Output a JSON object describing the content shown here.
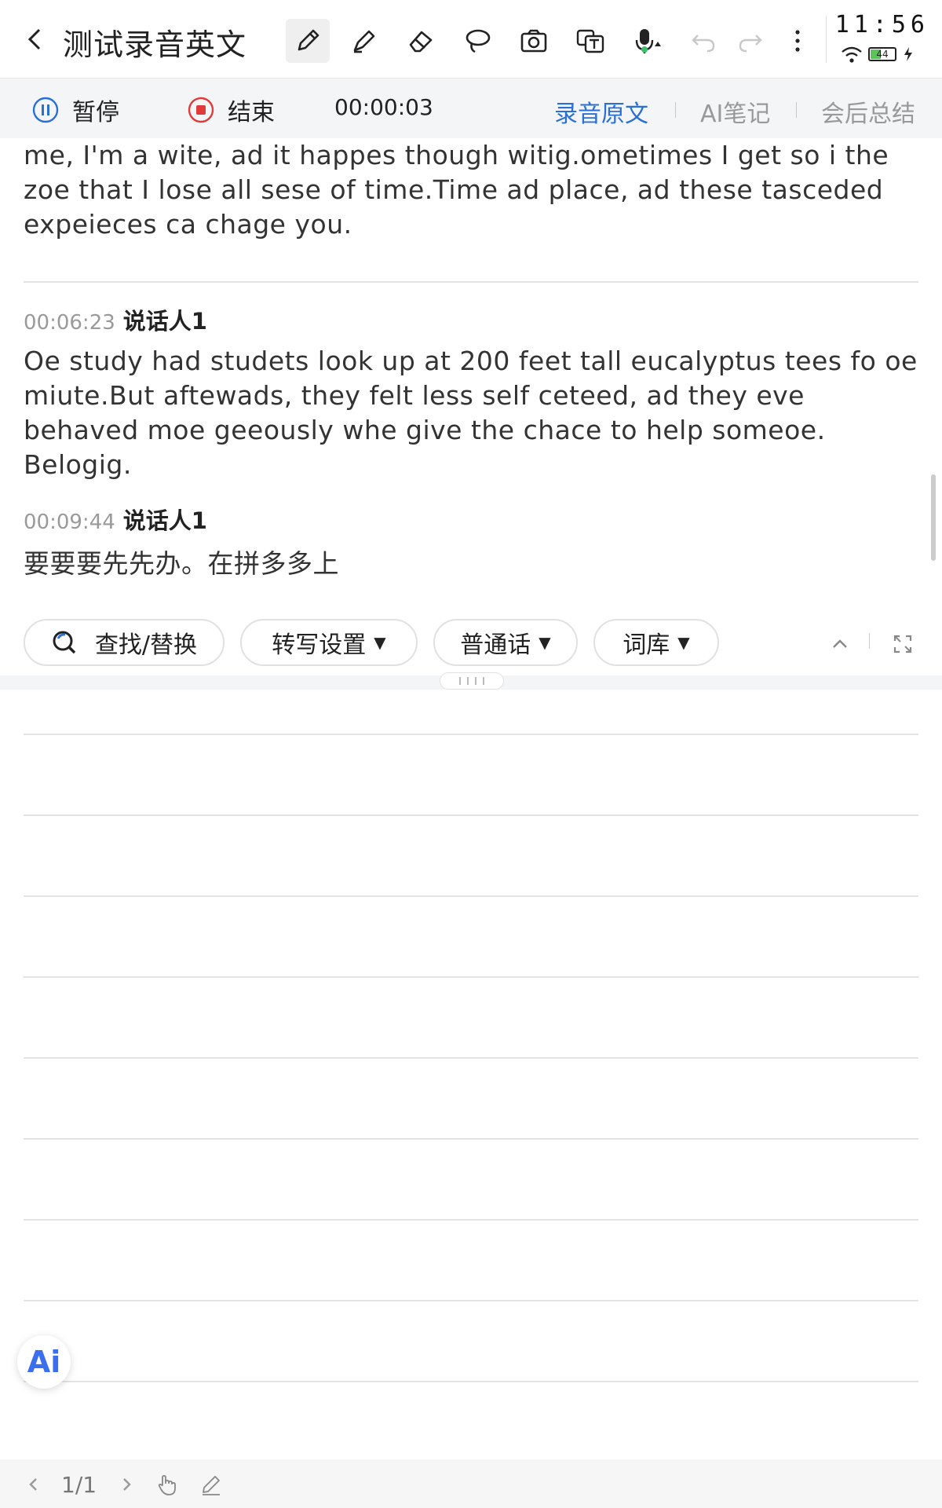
{
  "header": {
    "back_icon": "chevron-left-icon",
    "title": "测试录音英文",
    "tools": [
      "pen-icon",
      "highlighter-icon",
      "eraser-icon",
      "lasso-icon",
      "camera-icon",
      "translate-icon",
      "microphone-icon",
      "undo-icon",
      "redo-icon",
      "more-icon"
    ],
    "active_tool": "pen-icon"
  },
  "status": {
    "time": "11:56",
    "battery": "44"
  },
  "recording": {
    "pause_label": "暂停",
    "stop_label": "结束",
    "elapsed": "00:00:03",
    "tabs": [
      "录音原文",
      "AI笔记",
      "会后总结"
    ],
    "active_tab": "录音原文",
    "accent_color": "#2a6fd6"
  },
  "transcript": {
    "intro_text": "me, I'm a wite, ad it happes though witig.ometimes I get so i the zoe that I lose all sese of time.Time ad place, ad these tasceded expeieces ca chage you.",
    "segments": [
      {
        "time": "00:06:23",
        "speaker": "说话人1",
        "text": "Oe study had studets look up at 200 feet tall eucalyptus tees fo oe miute.But aftewads, they felt less self ceteed, ad they eve behaved moe geeously whe give the chace to help someoe. Belogig."
      },
      {
        "time": "00:09:44",
        "speaker": "说话人1",
        "text": "要要要先先办。在拼多多上"
      }
    ]
  },
  "toolbar": {
    "find_replace": "查找/替换",
    "transcribe_settings": "转写设置",
    "language": "普通话",
    "lexicon": "词库"
  },
  "ai_button": "Ai",
  "footer": {
    "page_indicator": "1/1"
  }
}
